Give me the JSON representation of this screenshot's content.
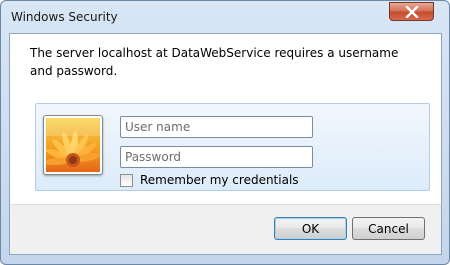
{
  "window": {
    "title": "Windows Security"
  },
  "message": "The server localhost at DataWebService requires a username and password.",
  "credentials": {
    "username": {
      "value": "",
      "placeholder": "User name"
    },
    "password": {
      "value": "",
      "placeholder": "Password"
    },
    "remember": {
      "label": "Remember my credentials",
      "checked": false
    },
    "tile_icon": "user-tile-flower-icon"
  },
  "buttons": {
    "ok": "OK",
    "cancel": "Cancel"
  },
  "colors": {
    "close_button": "#c64d2f",
    "panel_border": "#b5cbe6",
    "default_button_border": "#3c7fb1"
  }
}
